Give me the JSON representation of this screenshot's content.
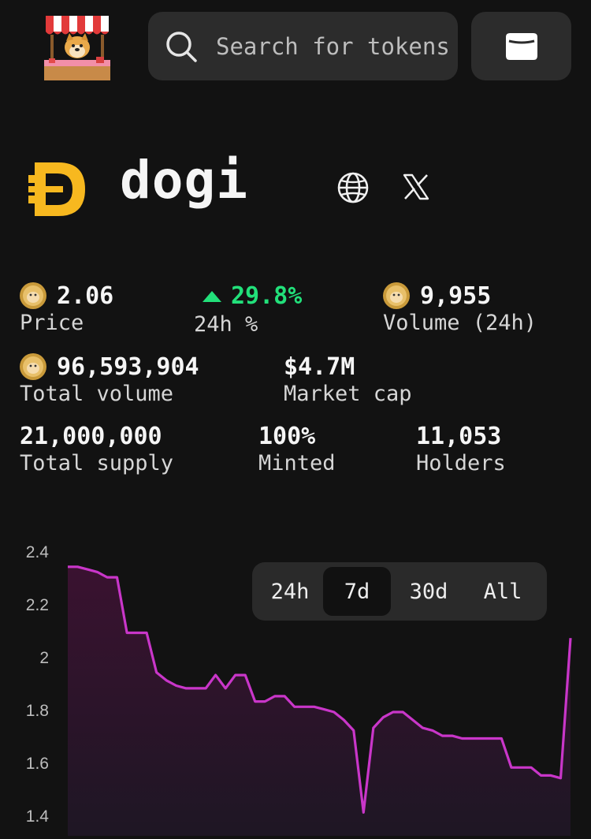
{
  "header": {
    "search_placeholder": "Search for tokens",
    "icons": {
      "logo": "shiba-market-stall-logo",
      "search": "search-icon",
      "wallet": "wallet-icon"
    }
  },
  "token": {
    "name": "dogi",
    "icons": {
      "logo": "dogi-d-logo",
      "website": "globe-icon",
      "social": "x-logo-icon"
    },
    "colors": {
      "logo": "#f7b81f"
    }
  },
  "stats": {
    "price": {
      "value": "2.06",
      "label": "Price"
    },
    "change": {
      "value": "29.8%",
      "label": "24h %",
      "direction": "up",
      "color": "#22e07a"
    },
    "volume24h": {
      "value": "9,955",
      "label": "Volume (24h)"
    },
    "total_volume": {
      "value": "96,593,904",
      "label": "Total volume"
    },
    "market_cap": {
      "value": "$4.7M",
      "label": "Market cap"
    },
    "total_supply": {
      "value": "21,000,000",
      "label": "Total supply"
    },
    "minted": {
      "value": "100%",
      "label": "Minted"
    },
    "holders": {
      "value": "11,053",
      "label": "Holders"
    }
  },
  "chart": {
    "range_buttons": [
      "24h",
      "7d",
      "30d",
      "All"
    ],
    "active_range": "7d",
    "y_ticks": [
      "2.4",
      "2.2",
      "2",
      "1.8",
      "1.6",
      "1.4"
    ],
    "line_color": "#c936c9"
  },
  "chart_data": {
    "type": "area",
    "ylim": [
      1.4,
      2.4
    ],
    "y": [
      2.35,
      2.35,
      2.34,
      2.33,
      2.31,
      2.31,
      2.1,
      2.1,
      2.1,
      1.95,
      1.92,
      1.9,
      1.89,
      1.89,
      1.89,
      1.94,
      1.89,
      1.94,
      1.94,
      1.84,
      1.84,
      1.86,
      1.86,
      1.82,
      1.82,
      1.82,
      1.81,
      1.8,
      1.77,
      1.73,
      1.42,
      1.74,
      1.78,
      1.8,
      1.8,
      1.77,
      1.74,
      1.73,
      1.71,
      1.71,
      1.7,
      1.7,
      1.7,
      1.7,
      1.7,
      1.59,
      1.59,
      1.59,
      1.56,
      1.56,
      1.55,
      2.08
    ]
  }
}
